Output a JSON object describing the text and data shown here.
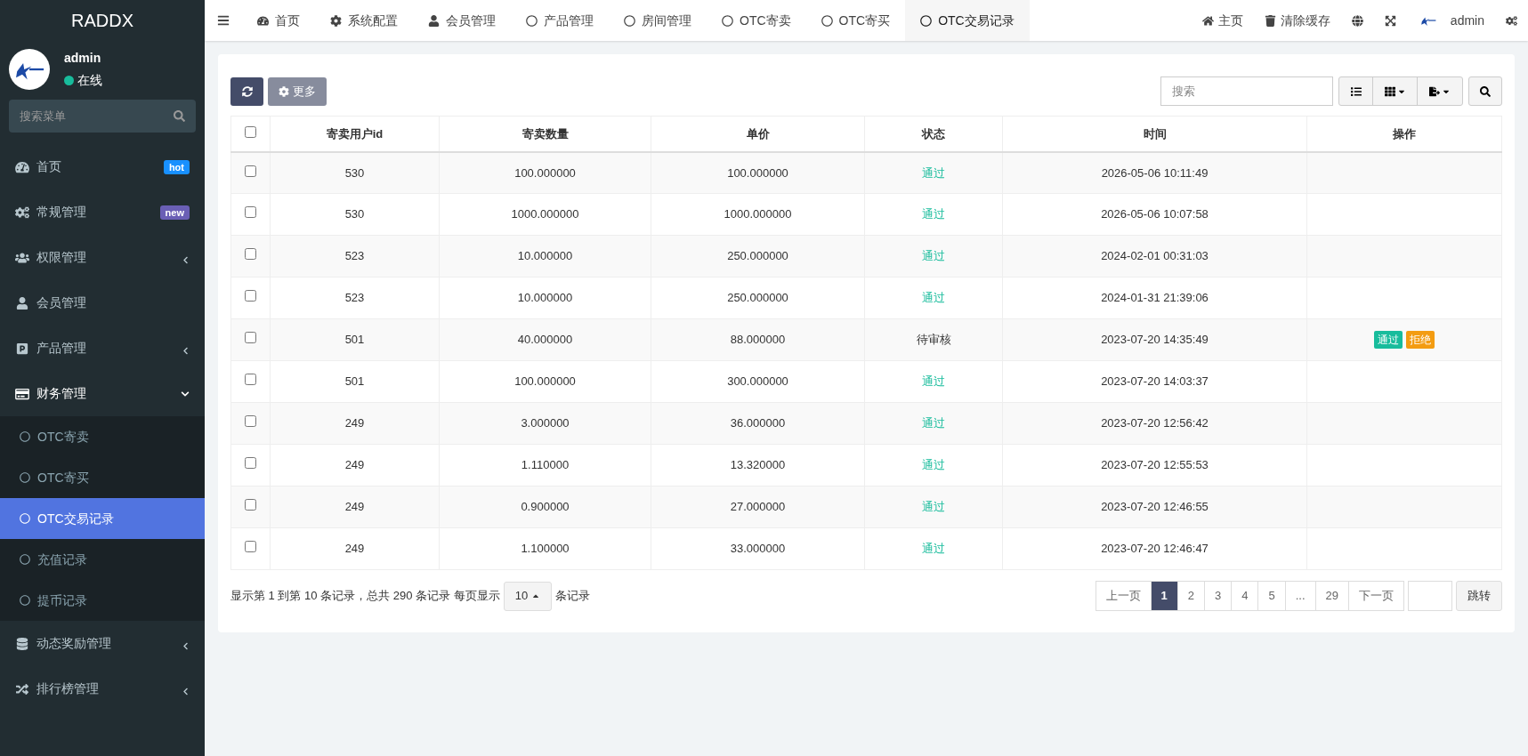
{
  "brand": "RADDX",
  "user": {
    "name": "admin",
    "status": "在线"
  },
  "sidebar_search": {
    "placeholder": "搜索菜单"
  },
  "sidebar": {
    "items": [
      {
        "label": "首页",
        "badge": {
          "text": "hot",
          "color": "#1890ff"
        },
        "selected": false
      },
      {
        "label": "常规管理",
        "badge": {
          "text": "new",
          "color": "#6a5fb5"
        },
        "selected": false
      },
      {
        "label": "权限管理",
        "expanded": false,
        "selected": false
      },
      {
        "label": "会员管理",
        "selected": false
      },
      {
        "label": "产品管理",
        "expanded": false,
        "selected": false
      },
      {
        "label": "财务管理",
        "expanded": true,
        "selected": false,
        "children": [
          {
            "label": "OTC寄卖",
            "selected": false
          },
          {
            "label": "OTC寄买",
            "selected": false
          },
          {
            "label": "OTC交易记录",
            "selected": true
          },
          {
            "label": "充值记录",
            "selected": false
          },
          {
            "label": "提币记录",
            "selected": false
          }
        ]
      },
      {
        "label": "动态奖励管理",
        "expanded": false,
        "selected": false
      },
      {
        "label": "排行榜管理",
        "expanded": false,
        "selected": false
      }
    ]
  },
  "tabs": [
    {
      "label": "首页",
      "selected": false
    },
    {
      "label": "系统配置",
      "selected": false
    },
    {
      "label": "会员管理",
      "selected": false
    },
    {
      "label": "产品管理",
      "selected": false
    },
    {
      "label": "房间管理",
      "selected": false
    },
    {
      "label": "OTC寄卖",
      "selected": false
    },
    {
      "label": "OTC寄买",
      "selected": false
    },
    {
      "label": "OTC交易记录",
      "selected": true
    }
  ],
  "top_right": {
    "home": "主页",
    "clear_cache": "清除缓存",
    "user": "admin"
  },
  "toolbar": {
    "more": "更多",
    "search": {
      "placeholder": "搜索"
    }
  },
  "table": {
    "all_checked": false,
    "columns": [
      "寄卖用户id",
      "寄卖数量",
      "单价",
      "状态",
      "时间",
      "操作"
    ],
    "rows": [
      {
        "checked": false,
        "cells": [
          "530",
          "100.000000",
          "100.000000"
        ],
        "status": {
          "text": "通过",
          "kind": "passed"
        },
        "time": "2026-05-06 10:11:49",
        "actions": []
      },
      {
        "checked": false,
        "cells": [
          "530",
          "1000.000000",
          "1000.000000"
        ],
        "status": {
          "text": "通过",
          "kind": "passed"
        },
        "time": "2026-05-06 10:07:58",
        "actions": []
      },
      {
        "checked": false,
        "cells": [
          "523",
          "10.000000",
          "250.000000"
        ],
        "status": {
          "text": "通过",
          "kind": "passed"
        },
        "time": "2024-02-01 00:31:03",
        "actions": []
      },
      {
        "checked": false,
        "cells": [
          "523",
          "10.000000",
          "250.000000"
        ],
        "status": {
          "text": "通过",
          "kind": "passed"
        },
        "time": "2024-01-31 21:39:06",
        "actions": []
      },
      {
        "checked": false,
        "cells": [
          "501",
          "40.000000",
          "88.000000"
        ],
        "status": {
          "text": "待审核",
          "kind": "pending"
        },
        "time": "2023-07-20 14:35:49",
        "actions": [
          {
            "label": "通过",
            "kind": "approve"
          },
          {
            "label": "拒绝",
            "kind": "reject"
          }
        ]
      },
      {
        "checked": false,
        "cells": [
          "501",
          "100.000000",
          "300.000000"
        ],
        "status": {
          "text": "通过",
          "kind": "passed"
        },
        "time": "2023-07-20 14:03:37",
        "actions": []
      },
      {
        "checked": false,
        "cells": [
          "249",
          "3.000000",
          "36.000000"
        ],
        "status": {
          "text": "通过",
          "kind": "passed"
        },
        "time": "2023-07-20 12:56:42",
        "actions": []
      },
      {
        "checked": false,
        "cells": [
          "249",
          "1.110000",
          "13.320000"
        ],
        "status": {
          "text": "通过",
          "kind": "passed"
        },
        "time": "2023-07-20 12:55:53",
        "actions": []
      },
      {
        "checked": false,
        "cells": [
          "249",
          "0.900000",
          "27.000000"
        ],
        "status": {
          "text": "通过",
          "kind": "passed"
        },
        "time": "2023-07-20 12:46:55",
        "actions": []
      },
      {
        "checked": false,
        "cells": [
          "249",
          "1.100000",
          "33.000000"
        ],
        "status": {
          "text": "通过",
          "kind": "passed"
        },
        "time": "2023-07-20 12:46:47",
        "actions": []
      }
    ]
  },
  "footer": {
    "summary": "显示第 1 到第 10 条记录，总共 290 条记录 每页显示",
    "page_size": "10",
    "suffix": "条记录"
  },
  "pagination": {
    "pages": [
      {
        "label": "上一页",
        "selected": false
      },
      {
        "label": "1",
        "selected": true
      },
      {
        "label": "2",
        "selected": false
      },
      {
        "label": "3",
        "selected": false
      },
      {
        "label": "4",
        "selected": false
      },
      {
        "label": "5",
        "selected": false
      },
      {
        "label": "...",
        "selected": false
      },
      {
        "label": "29",
        "selected": false
      },
      {
        "label": "下一页",
        "selected": false
      }
    ],
    "jump": "跳转"
  }
}
